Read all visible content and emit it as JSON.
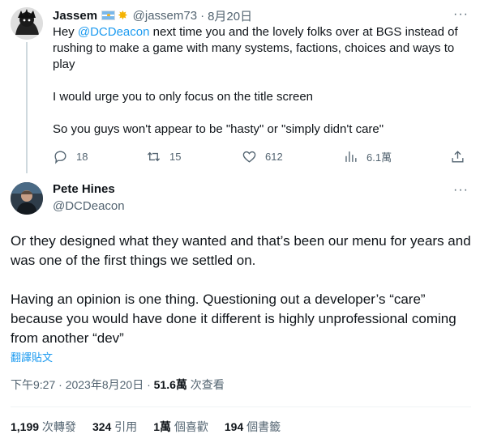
{
  "parent_tweet": {
    "author_name": "Jassem",
    "handle": "@jassem73",
    "dot": "·",
    "time": "8月20日",
    "badge_icons": [
      "argentina-flag-icon",
      "star-icon"
    ],
    "star_glyph": "✸",
    "more_glyph": "···",
    "text": {
      "line_hey": "Hey ",
      "mention": "@DCDeacon",
      "line_rest": " next time you and the lovely folks over at BGS instead of rushing to make a game with many systems, factions, choices and ways to play",
      "para2": "I would urge you to only focus on the title screen",
      "para3": "So you guys won't appear to be \"hasty\" or \"simply didn't care\""
    },
    "actions": {
      "replies": "18",
      "retweets": "15",
      "likes": "612",
      "views": "6.1萬"
    }
  },
  "main_tweet": {
    "author_name": "Pete Hines",
    "handle": "@DCDeacon",
    "more_glyph": "···",
    "para1": "Or they designed what they wanted and that’s been our menu for years and was one of the first things we settled on.",
    "para2": "Having an opinion is one thing. Questioning out a developer’s “care” because you would have done it different is highly unprofessional coming from another “dev”",
    "translate_link": "翻譯貼文",
    "meta": {
      "time": "下午9:27",
      "sep": " · ",
      "date": "2023年8月20日",
      "views_value": "51.6萬",
      "views_label": " 次查看"
    },
    "stats": {
      "retweets_value": "1,199",
      "retweets_label": " 次轉發",
      "quotes_value": "324",
      "quotes_label": " 引用",
      "likes_value": "1萬",
      "likes_label": " 個喜歡",
      "bookmarks_value": "194",
      "bookmarks_label": " 個書籤"
    }
  },
  "colors": {
    "link": "#1d9bf0",
    "secondary_text": "#536471",
    "primary_text": "#0f1419",
    "divider": "#eff3f4"
  }
}
